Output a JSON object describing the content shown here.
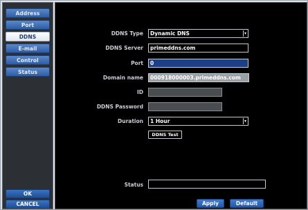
{
  "sidebar": {
    "items": [
      {
        "label": "Address"
      },
      {
        "label": "Port"
      },
      {
        "label": "DDNS"
      },
      {
        "label": "E-mail"
      },
      {
        "label": "Control"
      },
      {
        "label": "Status"
      }
    ],
    "ok_label": "OK",
    "cancel_label": "CANCEL",
    "active": "DDNS"
  },
  "form": {
    "ddns_type_label": "DDNS Type",
    "ddns_type_value": "Dynamic DNS",
    "ddns_server_label": "DDNS Server",
    "ddns_server_value": "primeddns.com",
    "port_label": "Port",
    "port_value": "0",
    "domain_label": "Domain name",
    "domain_value": "000918000003.primeddns.com",
    "id_label": "ID",
    "id_value": "",
    "password_label": "DDNS Password",
    "password_value": "",
    "duration_label": "Duration",
    "duration_value": "1 Hour",
    "ddns_test_label": "DDNS Test",
    "status_label": "Status",
    "status_value": ""
  },
  "footer": {
    "apply_label": "Apply",
    "default_label": "Default"
  },
  "colors": {
    "nav_blue": "#2d5da4",
    "field_blue": "#1d3f86",
    "background": "#000000"
  }
}
